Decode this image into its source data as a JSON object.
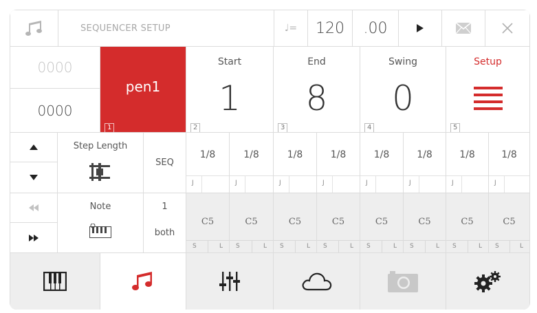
{
  "titlebar": {
    "title": "SEQUENCER SETUP",
    "tempo_symbol": "♩=",
    "tempo": "120",
    "tempo_fraction": ".00",
    "play_icon": "play-icon",
    "mail_icon": "mail-icon",
    "close_icon": "close-icon"
  },
  "counters": {
    "top": "0000",
    "bottom": "0000"
  },
  "pen": {
    "label": "pen1",
    "index": "1"
  },
  "params": [
    {
      "label": "Start",
      "value": "1",
      "index": "2"
    },
    {
      "label": "End",
      "value": "8",
      "index": "3"
    },
    {
      "label": "Swing",
      "value": "0",
      "index": "4"
    },
    {
      "label": "Setup",
      "value": "",
      "index": "5"
    }
  ],
  "step_row": {
    "label": "Step Length",
    "mode": "SEQ",
    "values": [
      "1/8",
      "1/8",
      "1/8",
      "1/8",
      "1/8",
      "1/8",
      "1/8",
      "1/8"
    ],
    "sub": [
      "J",
      "J",
      "J",
      "J",
      "J",
      "J",
      "J",
      "J"
    ]
  },
  "note_row": {
    "label": "Note",
    "count": "1",
    "mode": "both",
    "values": [
      "C5",
      "C5",
      "C5",
      "C5",
      "C5",
      "C5",
      "C5",
      "C5"
    ],
    "sub_s": "S",
    "sub_l": "L"
  },
  "tabs": [
    {
      "name": "keyboard-tab",
      "icon": "piano-keys-icon"
    },
    {
      "name": "sequencer-tab",
      "icon": "music-notes-icon"
    },
    {
      "name": "mixer-tab",
      "icon": "sliders-icon"
    },
    {
      "name": "cloud-tab",
      "icon": "cloud-icon"
    },
    {
      "name": "camera-tab",
      "icon": "camera-icon"
    },
    {
      "name": "settings-tab",
      "icon": "gears-icon"
    }
  ],
  "colors": {
    "accent": "#d42c2c",
    "grid": "#dcdcdc",
    "cell": "#ffffff",
    "cell_alt": "#eeeeee"
  }
}
